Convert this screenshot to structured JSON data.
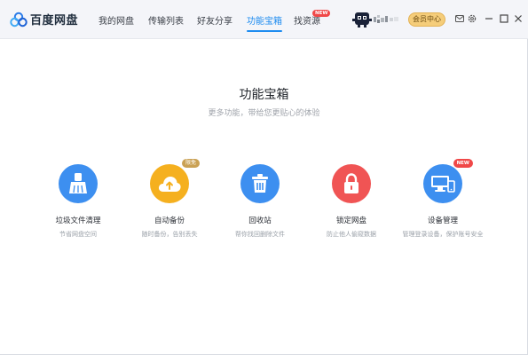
{
  "app": {
    "name": "百度网盘"
  },
  "nav": {
    "items": [
      {
        "label": "我的网盘"
      },
      {
        "label": "传输列表"
      },
      {
        "label": "好友分享"
      },
      {
        "label": "功能宝箱"
      },
      {
        "label": "找资源"
      }
    ],
    "active_index": 3,
    "new_badge": "NEW"
  },
  "user": {
    "vip_label": "会员中心"
  },
  "window_icons": [
    "mail-icon",
    "settings-icon",
    "minimize-icon",
    "maximize-icon",
    "close-icon"
  ],
  "page": {
    "title": "功能宝箱",
    "subtitle": "更多功能，带给您更贴心的体验"
  },
  "tools": [
    {
      "name": "垃圾文件清理",
      "desc": "节省网盘空间",
      "color": "#3d8ff0",
      "icon": "broom-icon"
    },
    {
      "name": "自动备份",
      "desc": "随时备份，告别丢失",
      "color": "#f5b01f",
      "icon": "cloud-upload-icon",
      "badge": "限免"
    },
    {
      "name": "回收站",
      "desc": "帮你找回删除文件",
      "color": "#3d8ff0",
      "icon": "trash-icon"
    },
    {
      "name": "锁定网盘",
      "desc": "防止他人偷窥数据",
      "color": "#f05454",
      "icon": "lock-icon"
    },
    {
      "name": "设备管理",
      "desc": "管理登录设备，保护账号安全",
      "color": "#3d8ff0",
      "icon": "devices-icon",
      "badge": "NEW"
    }
  ],
  "colors": {
    "accent": "#1e8cf0",
    "titlebar_bg": "#f4f5f9",
    "vip_gold": "#f5cd7a",
    "new_red": "#f04848"
  }
}
